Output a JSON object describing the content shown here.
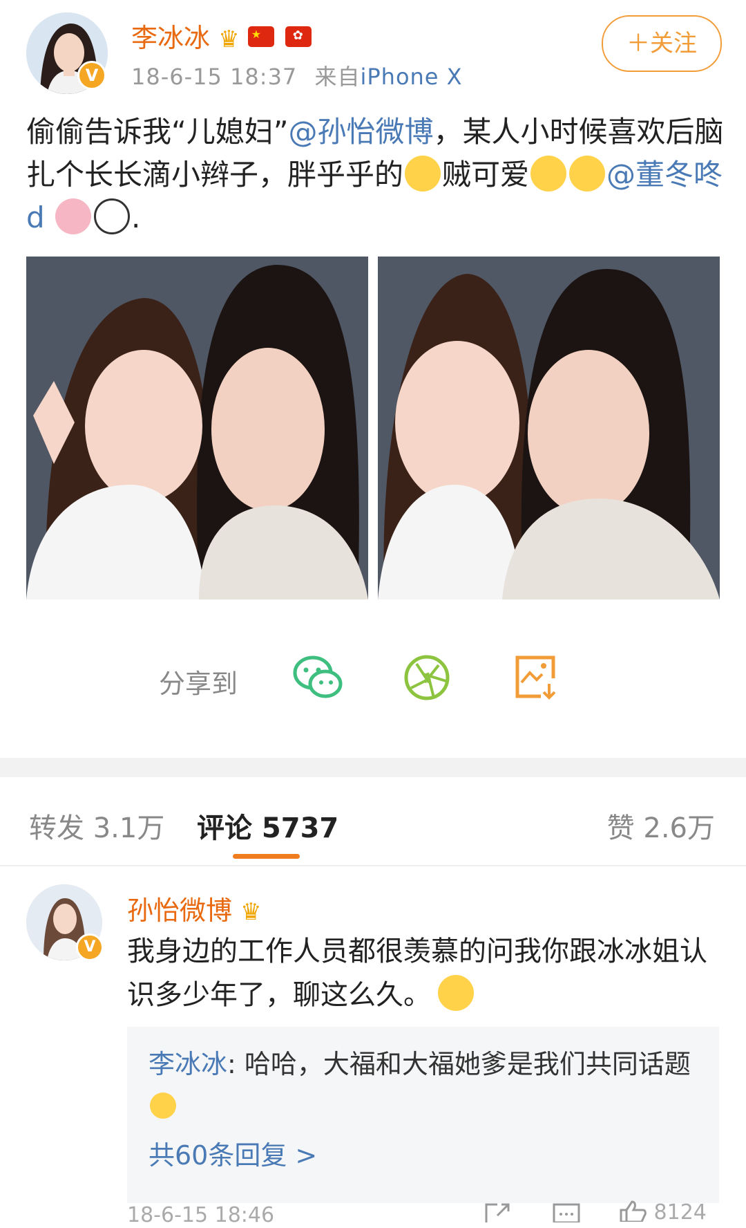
{
  "post": {
    "author": "李冰冰",
    "timestamp": "18-6-15 18:37",
    "source_prefix": "来自",
    "source_device": "iPhone X",
    "follow_label": "＋关注",
    "text_1": "偷偷告诉我“儿媳妇”",
    "mention_1": "@孙怡微博",
    "text_2": "，某人小时候喜欢后脑扎个长长滴小辫子，胖乎乎的",
    "text_3": "贼可爱",
    "mention_2": "@董冬咚d",
    "text_end": "."
  },
  "share": {
    "label": "分享到",
    "icons": [
      "wechat-icon",
      "moments-icon",
      "save-image-icon"
    ]
  },
  "tabs": {
    "repost": "转发 3.1万",
    "comments": "评论 5737",
    "likes": "赞 2.6万"
  },
  "comment": {
    "author": "孙怡微博",
    "text": "我身边的工作人员都很羡慕的问我你跟冰冰姐认识多少年了，聊这么久。",
    "reply_author": "李冰冰",
    "reply_separator": ": ",
    "reply_text": "哈哈，大福和大福她爹是我们共同话题",
    "reply_count": "共60条回复 >",
    "timestamp": "18-6-15 18:46",
    "like_count": "8124"
  },
  "colors": {
    "accent_orange": "#e8690f",
    "link_blue": "#4a7ab5",
    "wechat_green": "#3fbf7f",
    "moments_green": "#8dc43f",
    "save_orange": "#f29c38"
  }
}
